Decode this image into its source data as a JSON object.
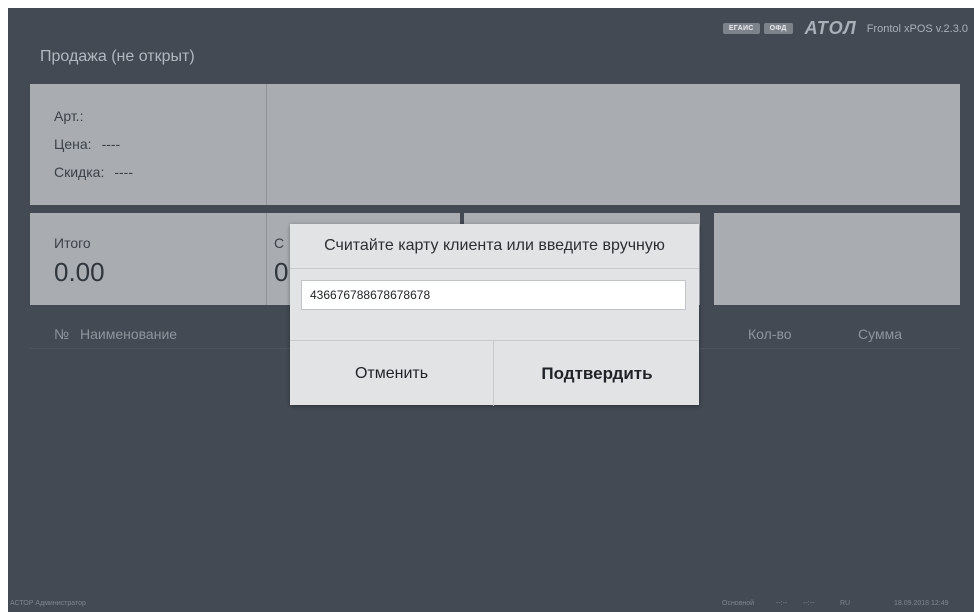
{
  "header": {
    "badges": [
      "ЕГАИС",
      "ОФД"
    ],
    "brand": "АТОЛ",
    "version": "Frontol xPOS v.2.3.0",
    "mode_title": "Продажа (не открыт)"
  },
  "item_info": {
    "article_label": "Арт.:",
    "article_value": "",
    "price_label": "Цена:",
    "price_value": "----",
    "discount_label": "Скидка:",
    "discount_value": "----"
  },
  "totals": {
    "total_label": "Итого",
    "total_value": "0.00",
    "second_label_fragment": "С",
    "second_value_fragment": "0"
  },
  "table": {
    "columns": [
      "№",
      "Наименование",
      "Кол-во",
      "Сумма"
    ]
  },
  "dialog": {
    "title": "Считайте карту клиента или введите вручную",
    "input_value": "436676788678678678",
    "cancel_label": "Отменить",
    "confirm_label": "Подтвердить"
  },
  "status_bar": {
    "user": "АСТОР Администратор",
    "mode": "Основной",
    "field1": "--:--",
    "field2": "--:--",
    "lang": "RU",
    "datetime": "18.09.2018 12:49"
  }
}
